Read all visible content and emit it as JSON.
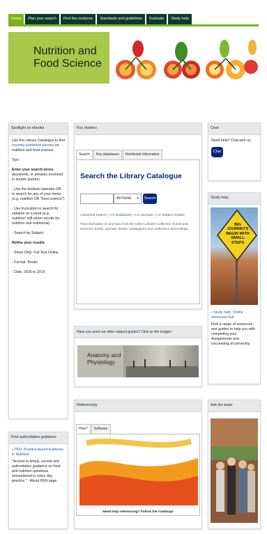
{
  "nav": {
    "tabs": [
      {
        "label": "Home",
        "active": true
      },
      {
        "label": "Plan your search",
        "active": false
      },
      {
        "label": "Find the evidence",
        "active": false
      },
      {
        "label": "Standards and guidelines",
        "active": false
      },
      {
        "label": "Evaluate",
        "active": false
      },
      {
        "label": "Study help",
        "active": false
      }
    ]
  },
  "banner": {
    "title_line1": "Nutrition and",
    "title_line2": "Food Science"
  },
  "spotlight": {
    "heading": "Spotlight on ebooks",
    "intro_text": "Use the Library Catalogue to find ",
    "intro_link": "recently-published ebooks",
    "intro_end": " on nutrition and food science.",
    "tips_label": "Tips:",
    "enter_bold": "Enter your search terms",
    "enter_rest": " (keywords, or phrases enclosed in double quotes)",
    "boolean": "- Use the boolean operator OR to search for any of your terms (e.g. nutrition OR \"food science\")",
    "truncation": "- Use truncation to search for variants on a word (e.g. nutrition* will return results for nutrition and nutritional)",
    "search_by": "- Search by Subject",
    "refine_label": "Refine your results",
    "show_only": "- Show Only: Full Text Online",
    "format": "- Format: Books",
    "date": "- Date: 2016 to 2019"
  },
  "key_starters": {
    "heading": "Key starters",
    "tabs": [
      "Search",
      "Key databases",
      "Nutritional information"
    ],
    "search_title": "Search the Library Catalogue",
    "select_value": "All Fields",
    "search_button": "Search",
    "link_advanced": "Advanced Search",
    "link_az_db": "A-Z Databases",
    "link_az_journals": "A-Z Journals",
    "link_az_subject": "A-Z Subject Guides",
    "separator": " | ",
    "note": "Find information on any topic from the UniSA Library's collection of print and electronic books, journals, theses, newspapers and conference proceedings."
  },
  "chat": {
    "heading": "Chat",
    "text": "Need help? Chat with us",
    "button": "Chat"
  },
  "study_help": {
    "heading": "Study help",
    "sign_line1": "BIG",
    "sign_line2": "JOURNEYS",
    "sign_line3": "BEGIN WITH",
    "sign_line4": "SMALL",
    "sign_line5": "STEPS",
    "link": "Study help: Online resources hub",
    "text": "Find a range of resources and guides to help you with completing your Assignments and succeeding at university."
  },
  "subject_guides": {
    "heading": "Have you seen our other subject guides? Click on the images",
    "image_label_line1": "Anatomy and",
    "image_label_line2": "Physiology"
  },
  "authoritative": {
    "heading": "Find authoritative guidance",
    "link": "PEN: Practice-based Evidence in Nutrition",
    "text": "\"Access to timely, current and authoritative guidance on food and nutrition questions encountered in every day practice.\" - About PEN page"
  },
  "referencing": {
    "heading": "Referencing",
    "tabs": [
      "How?",
      "Software"
    ],
    "caption": "Need help referencing? Follow the roadmap!"
  },
  "ask_team": {
    "heading": "Ask the team"
  }
}
